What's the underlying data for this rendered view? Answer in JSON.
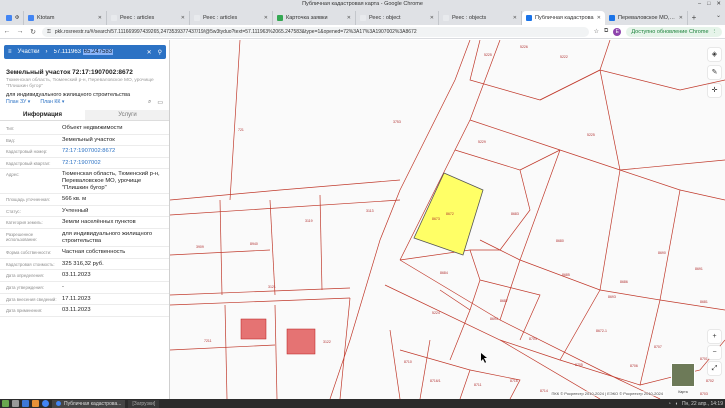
{
  "window": {
    "title": "Публичная кадастровая карта - Google Chrome"
  },
  "tabs": [
    {
      "label": "Ф",
      "color": "#4285f4",
      "active": false
    },
    {
      "label": "Ktotam",
      "color": "#4285f4",
      "active": false
    },
    {
      "label": "Реес : articles",
      "color": "#e8eaed",
      "active": false
    },
    {
      "label": "Реес : articles",
      "color": "#e8eaed",
      "active": false
    },
    {
      "label": "Карточка заявки",
      "color": "#34a853",
      "active": false
    },
    {
      "label": "Реес : object",
      "color": "#e8eaed",
      "active": false
    },
    {
      "label": "Реес : objects",
      "color": "#e8eaed",
      "active": false
    },
    {
      "label": "Публичная кадастрова",
      "color": "#1a73e8",
      "active": true
    },
    {
      "label": "Перевалов­ское МО, урочище",
      "color": "#1a73e8",
      "active": false
    }
  ],
  "toolbar": {
    "url": "pkk.rosreestr.ru/#/search/57.111669997439265,2473539377437/19/@5w3tyduo?text=57.111963%2065.247583&type=1&opened=72%3A17%3A1907002%3A8672",
    "avatar": "E",
    "update_label": "Доступно обновление Chrome"
  },
  "search": {
    "type_label": "Участки",
    "query_prefix": "57.111963",
    "query_selected": "65.247583"
  },
  "object": {
    "title": "Земельный участок 72:17:1907002:8672",
    "address_hint": "Тюменская область, Тюменский р-н, Переваловское МО, урочище \"Плишкин бугор\"",
    "use": "для индивидуального жилищного строительства",
    "plan_zu": "План ЗУ",
    "plan_kk": "План КК"
  },
  "info_tabs": {
    "info": "Информация",
    "services": "Услуги"
  },
  "properties": [
    {
      "k": "Тип:",
      "v": "Объект недвижимости",
      "link": false
    },
    {
      "k": "Вид:",
      "v": "Земельный участок",
      "link": false
    },
    {
      "k": "Кадастровый номер:",
      "v": "72:17:1907002:8672",
      "link": true
    },
    {
      "k": "Кадастровый квартал:",
      "v": "72:17:1907002",
      "link": true
    },
    {
      "k": "Адрес:",
      "v": "Тюменская область, Тюменский р-н, Переваловское МО, урочище \"Плишкин бугор\"",
      "link": false
    },
    {
      "k": "Площадь уточненная:",
      "v": "566 кв. м",
      "link": false
    },
    {
      "k": "Статус:",
      "v": "Учтенный",
      "link": false
    },
    {
      "k": "Категория земель:",
      "v": "Земли населённых пунктов",
      "link": false
    },
    {
      "k": "Разрешенное использование:",
      "v": "для индивидуального жилищного строительства",
      "link": false
    },
    {
      "k": "Форма собственности:",
      "v": "Частная собственность",
      "link": false
    },
    {
      "k": "Кадастровая стоимость:",
      "v": "325 316,32 руб.",
      "link": false
    },
    {
      "k": "Дата определения:",
      "v": "03.11.2023",
      "link": false
    },
    {
      "k": "Дата утверждения:",
      "v": "-",
      "link": false
    },
    {
      "k": "Дата внесения сведений:",
      "v": "17.11.2023",
      "link": false
    },
    {
      "k": "Дата применения:",
      "v": "03.11.2023",
      "link": false
    }
  ],
  "map": {
    "labels": [
      "5225",
      "5226",
      "5222",
      "3753",
      "5229",
      "5225",
      "721",
      "8673",
      "8672",
      "8683",
      "8680",
      "8684",
      "8685",
      "8686",
      "8687",
      "8690",
      "8691",
      "8693",
      "8672-1",
      "8681",
      "3113",
      "3119",
      "8940",
      "3909",
      "3121",
      "7211",
      "3122",
      "8694",
      "5224",
      "8704",
      "8705",
      "8706",
      "8707",
      "8710",
      "8716/1",
      "8711",
      "8716",
      "8714",
      "8701",
      "8702",
      "8703"
    ],
    "attribution": "ПКК © Росреестр 2010-2024 | ЕЭКО © Росреестр 2010-2024",
    "minimap_label": "Карта"
  },
  "taskbar": {
    "app_window": "Публичная кадастрова...",
    "second": "[Загрузки]",
    "tray": "Пн, 22 апр., 14:19"
  }
}
